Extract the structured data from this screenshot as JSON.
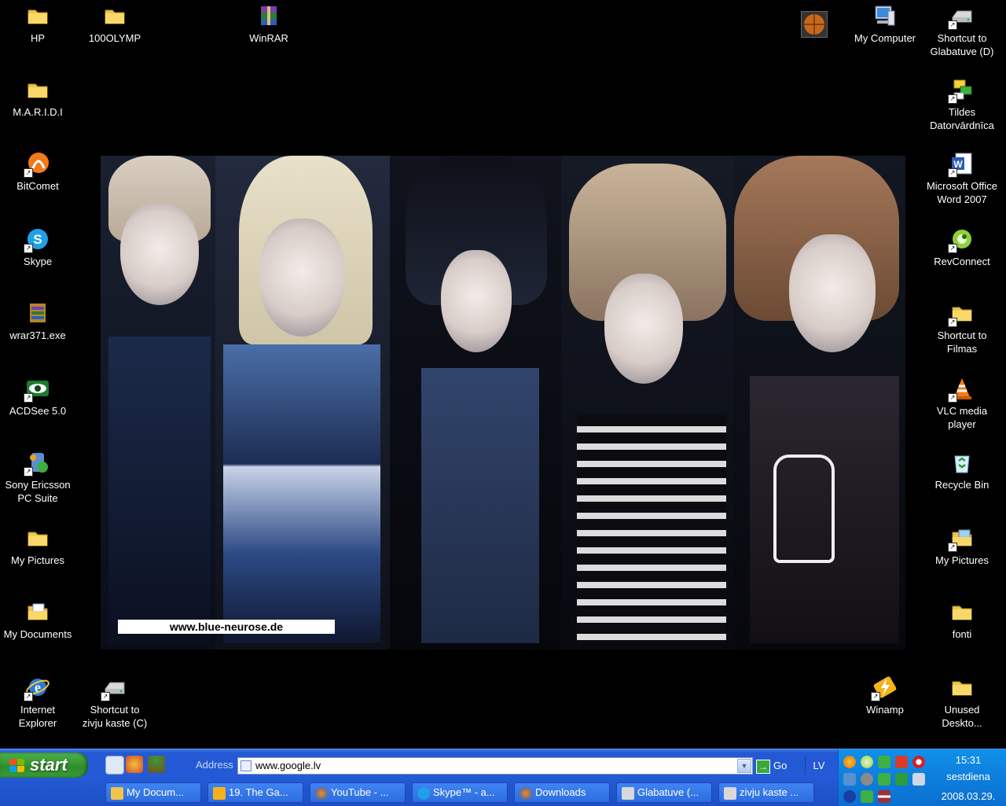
{
  "desktop_icons": {
    "hp": "HP",
    "olymp": "100OLYMP",
    "winrar": "WinRAR",
    "my_computer": "My Computer",
    "shortcut_glabatuve": "Shortcut to Glabatuve (D)",
    "maridi": "M.A.R.I.D.I",
    "tildes": "Tildes Datorvārdnīca",
    "bitcomet": "BitComet",
    "word": "Microsoft Office Word 2007",
    "skype": "Skype",
    "revconnect": "RevConnect",
    "wrar": "wrar371.exe",
    "shortcut_filmas": "Shortcut to Filmas",
    "acdsee": "ACDSee 5.0",
    "vlc": "VLC media player",
    "sony": "Sony Ericsson PC Suite",
    "recycle": "Recycle Bin",
    "my_pictures_left": "My Pictures",
    "my_pictures_right": "My Pictures",
    "my_documents": "My Documents",
    "fonti": "fonti",
    "ie": "Internet Explorer",
    "shortcut_zivju": "Shortcut to zivju kaste (C)",
    "winamp": "Winamp",
    "unused": "Unused Deskto..."
  },
  "wallpaper": {
    "url_text": "www.blue-neurose.de"
  },
  "taskbar": {
    "start_label": "start",
    "address_label": "Address",
    "address_value": "www.google.lv",
    "go_label": "Go",
    "language": "LV",
    "tasks": [
      {
        "label": "My Docum..."
      },
      {
        "label": "19. The Ga..."
      },
      {
        "label": "YouTube - ..."
      },
      {
        "label": "Skype™ - a..."
      },
      {
        "label": "Downloads"
      },
      {
        "label": "Glabatuve (..."
      },
      {
        "label": "zivju kaste ..."
      }
    ]
  },
  "tray": {
    "time": "15:31",
    "day": "sestdiena",
    "date": "2008.03.29."
  }
}
